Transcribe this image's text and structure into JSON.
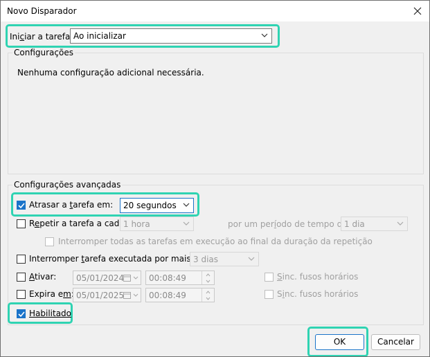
{
  "window": {
    "title": "Novo Disparador"
  },
  "trigger": {
    "label": "Iniciar a tarefa:",
    "label_pre": "Ini",
    "label_key": "c",
    "label_post": "iar a tarefa:",
    "value": "Ao inicializar"
  },
  "config": {
    "group_title": "Configurações",
    "message": "Nenhuma configuração adicional necessária."
  },
  "advanced": {
    "group_title": "Configurações avançadas",
    "delay": {
      "checked": true,
      "label_pre": "Atrasar a ",
      "label_key": "t",
      "label_post": "arefa em:",
      "value": "20 segundos"
    },
    "repeat": {
      "checked": false,
      "label_pre": "R",
      "label_key": "e",
      "label_post": "petir a tarefa a cada:",
      "value": "1 hora",
      "duration_label_pre": "por um per",
      "duration_label_key": "í",
      "duration_label_post": "odo de tempo de:",
      "duration_value": "1 dia"
    },
    "stop_all": {
      "checked": false,
      "label": "Interromper todas as tarefas em execução ao final da duração da repetição"
    },
    "stop_longer": {
      "checked": false,
      "label_pre": "Interromper ",
      "label_key": "t",
      "label_post": "arefa executada por mais de:",
      "value": "3 dias"
    },
    "activate": {
      "checked": false,
      "label_pre": "",
      "label_key": "A",
      "label_post": "tivar:",
      "date": "05/01/2024",
      "time": "00:08:49",
      "sync_pre": "",
      "sync_key": "S",
      "sync_post": "inc. fusos horários",
      "sync_checked": false
    },
    "expire": {
      "checked": false,
      "label_pre": "Expira e",
      "label_key": "m",
      "label_post": ":",
      "date": "05/01/2025",
      "time": "00:08:49",
      "sync_pre": "S",
      "sync_key": "i",
      "sync_post": "nc. fusos horários",
      "sync_checked": false
    },
    "enabled": {
      "checked": true,
      "label": "Habilitado"
    }
  },
  "buttons": {
    "ok": "OK",
    "cancel": "Cancelar"
  },
  "colors": {
    "highlight": "#2fd3b2",
    "check_accent": "#1a73c9"
  }
}
